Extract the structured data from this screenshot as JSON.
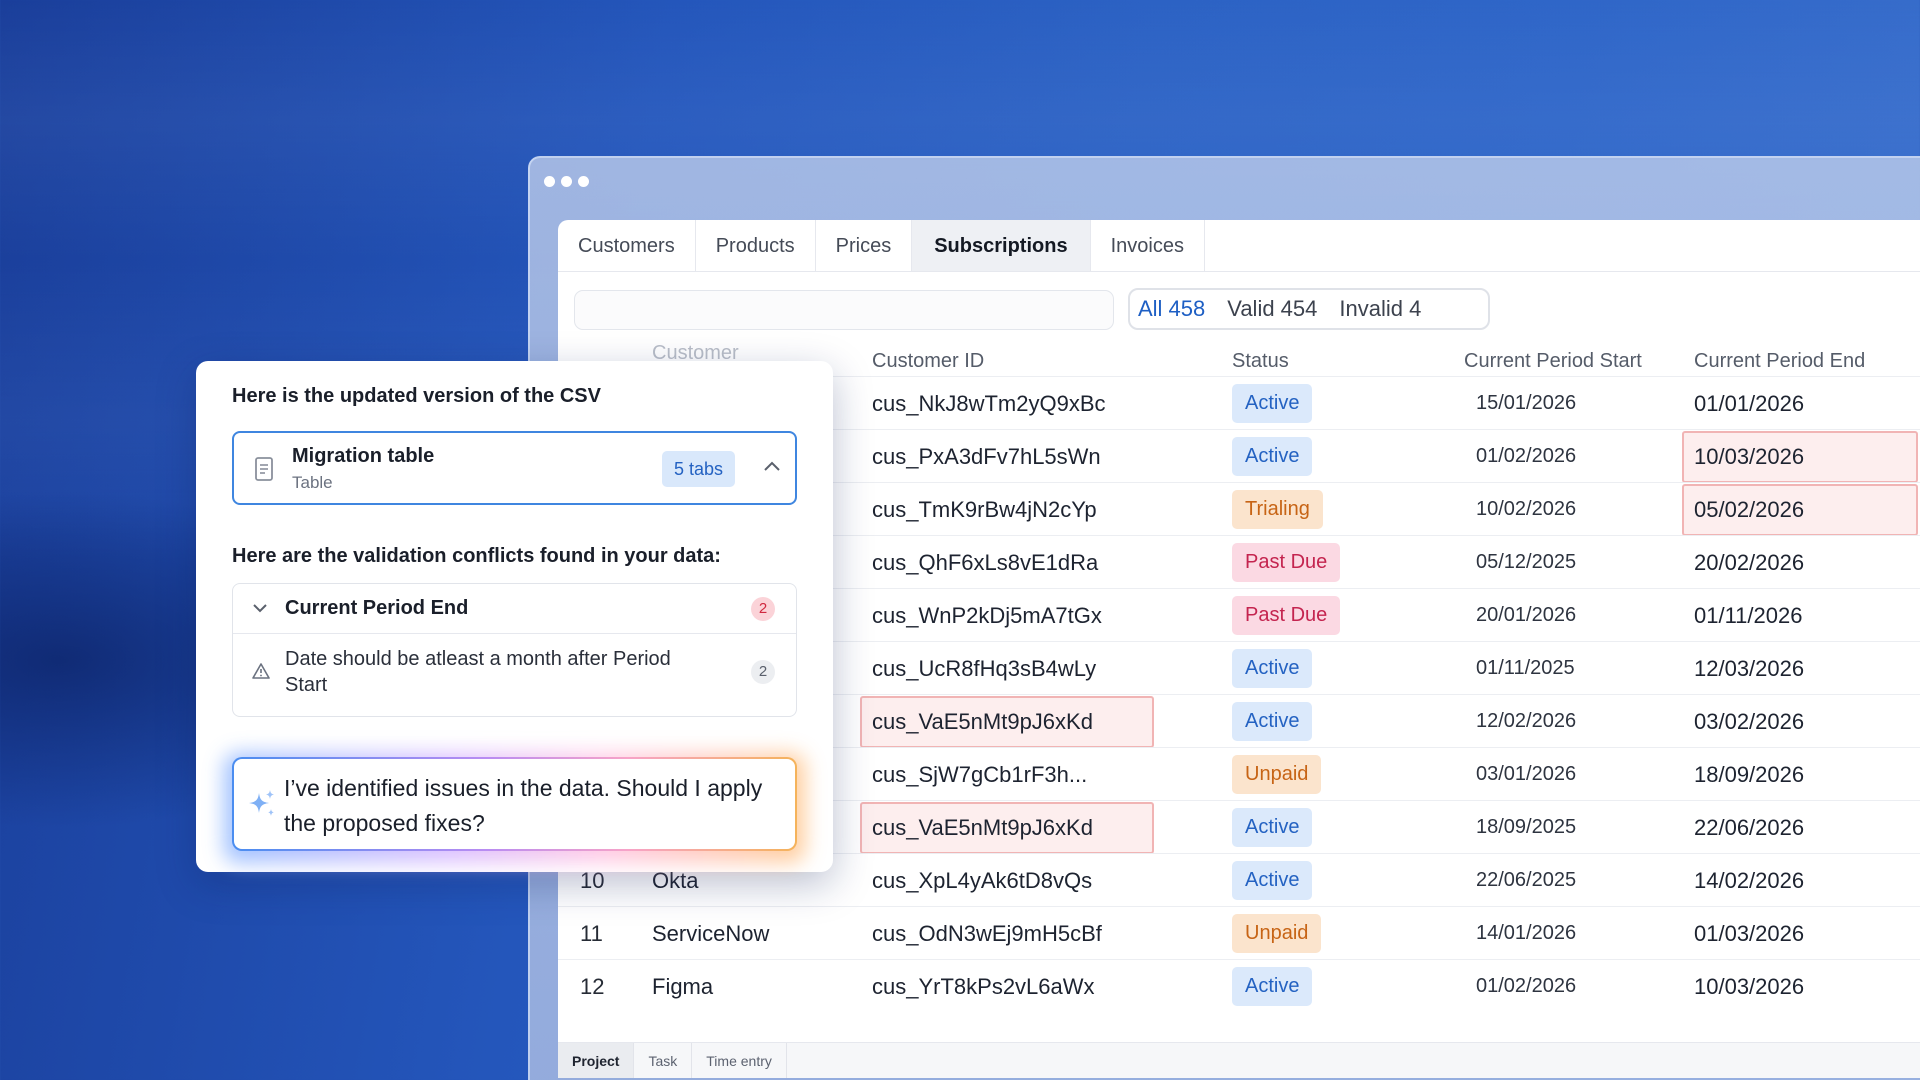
{
  "app": {
    "tabs": [
      {
        "label": "Customers"
      },
      {
        "label": "Products"
      },
      {
        "label": "Prices"
      },
      {
        "label": "Subscriptions",
        "active": true
      },
      {
        "label": "Invoices"
      }
    ],
    "filters": {
      "all": "All 458",
      "valid": "Valid 454",
      "invalid": "Invalid 4"
    },
    "columns": {
      "customer": "Customer",
      "customer_id": "Customer ID",
      "status": "Status",
      "period_start": "Current Period Start",
      "period_end": "Current Period End"
    },
    "rows": [
      {
        "num": "",
        "name": "",
        "id": "cus_NkJ8wTm2yQ9xBc",
        "status": "Active",
        "start": "15/01/2026",
        "end": "01/01/2026"
      },
      {
        "num": "",
        "name": "",
        "id": "cus_PxA3dFv7hL5sWn",
        "status": "Active",
        "start": "01/02/2026",
        "end": "10/03/2026"
      },
      {
        "num": "",
        "name": "",
        "id": "cus_TmK9rBw4jN2cYp",
        "status": "Trialing",
        "start": "10/02/2026",
        "end": "05/02/2026"
      },
      {
        "num": "",
        "name": "",
        "id": "cus_QhF6xLs8vE1dRa",
        "status": "Past Due",
        "start": "05/12/2025",
        "end": "20/02/2026"
      },
      {
        "num": "",
        "name": "",
        "id": "cus_WnP2kDj5mA7tGx",
        "status": "Past Due",
        "start": "20/01/2026",
        "end": "01/11/2026"
      },
      {
        "num": "",
        "name": "",
        "id": "cus_UcR8fHq3sB4wLy",
        "status": "Active",
        "start": "01/11/2025",
        "end": "12/03/2026"
      },
      {
        "num": "",
        "name": "",
        "id": "cus_VaE5nMt9pJ6xKd",
        "status": "Active",
        "start": "12/02/2026",
        "end": "03/02/2026"
      },
      {
        "num": "",
        "name": "",
        "id": "cus_SjW7gCb1rF3h...",
        "status": "Unpaid",
        "start": "03/01/2026",
        "end": "18/09/2026"
      },
      {
        "num": "",
        "name": "",
        "id": "cus_VaE5nMt9pJ6xKd",
        "status": "Active",
        "start": "18/09/2025",
        "end": "22/06/2026"
      },
      {
        "num": "10",
        "name": "Okta",
        "id": "cus_XpL4yAk6tD8vQs",
        "status": "Active",
        "start": "22/06/2025",
        "end": "14/02/2026"
      },
      {
        "num": "11",
        "name": "ServiceNow",
        "id": "cus_OdN3wEj9mH5cBf",
        "status": "Unpaid",
        "start": "14/01/2026",
        "end": "01/03/2026"
      },
      {
        "num": "12",
        "name": "Figma",
        "id": "cus_YrT8kPs2vL6aWx",
        "status": "Active",
        "start": "01/02/2026",
        "end": "10/03/2026"
      }
    ],
    "bottom_tabs": [
      {
        "label": "Project",
        "active": true
      },
      {
        "label": "Task"
      },
      {
        "label": "Time entry"
      }
    ],
    "status_colors": {
      "Active": "#2462c2",
      "Trialing": "#c76415",
      "Past Due": "#c4244f",
      "Unpaid": "#c76415",
      "error_border": "#f1b4b4"
    }
  },
  "assistant": {
    "title": "Here is the updated version of the CSV",
    "attachment": {
      "title": "Migration table",
      "subtitle": "Table",
      "badge": "5 tabs",
      "icon": "document-icon"
    },
    "conflicts_title": "Here are the validation conflicts found in your data:",
    "conflict": {
      "field": "Current Period End",
      "count": "2",
      "message": "Date should be atleast a month after Period Start",
      "message_count": "2"
    },
    "prompt": "I’ve identified issues in the data. Should I apply the proposed fixes?"
  }
}
